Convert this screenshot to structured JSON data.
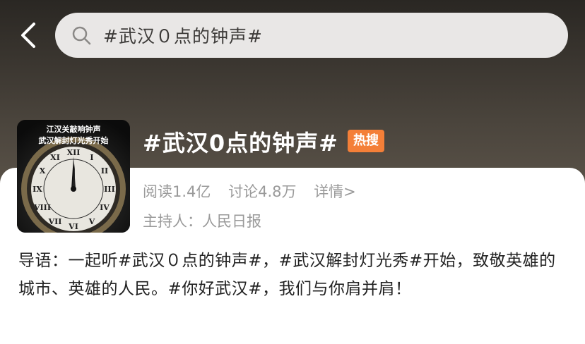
{
  "header": {
    "search_query": "#武汉０点的钟声#"
  },
  "topic": {
    "thumbnail_caption_line1": "江汉关敲响钟声",
    "thumbnail_caption_line2": "武汉解封灯光秀开始",
    "title": "#武汉0点的钟声#",
    "badge": "热搜",
    "reads": "阅读1.4亿",
    "discussions": "讨论4.8万",
    "details_link": "详情>",
    "host": "主持人：人民日报",
    "intro": "导语：一起听#武汉０点的钟声#，#武汉解封灯光秀#开始，致敬英雄的城市、英雄的人民。#你好武汉#，我们与你肩并肩！"
  },
  "colors": {
    "badge": "#f47f38",
    "search_bg": "#e9e7e6",
    "muted_text": "#9a9a9a"
  },
  "icons": [
    "back-arrow-icon",
    "search-icon"
  ]
}
